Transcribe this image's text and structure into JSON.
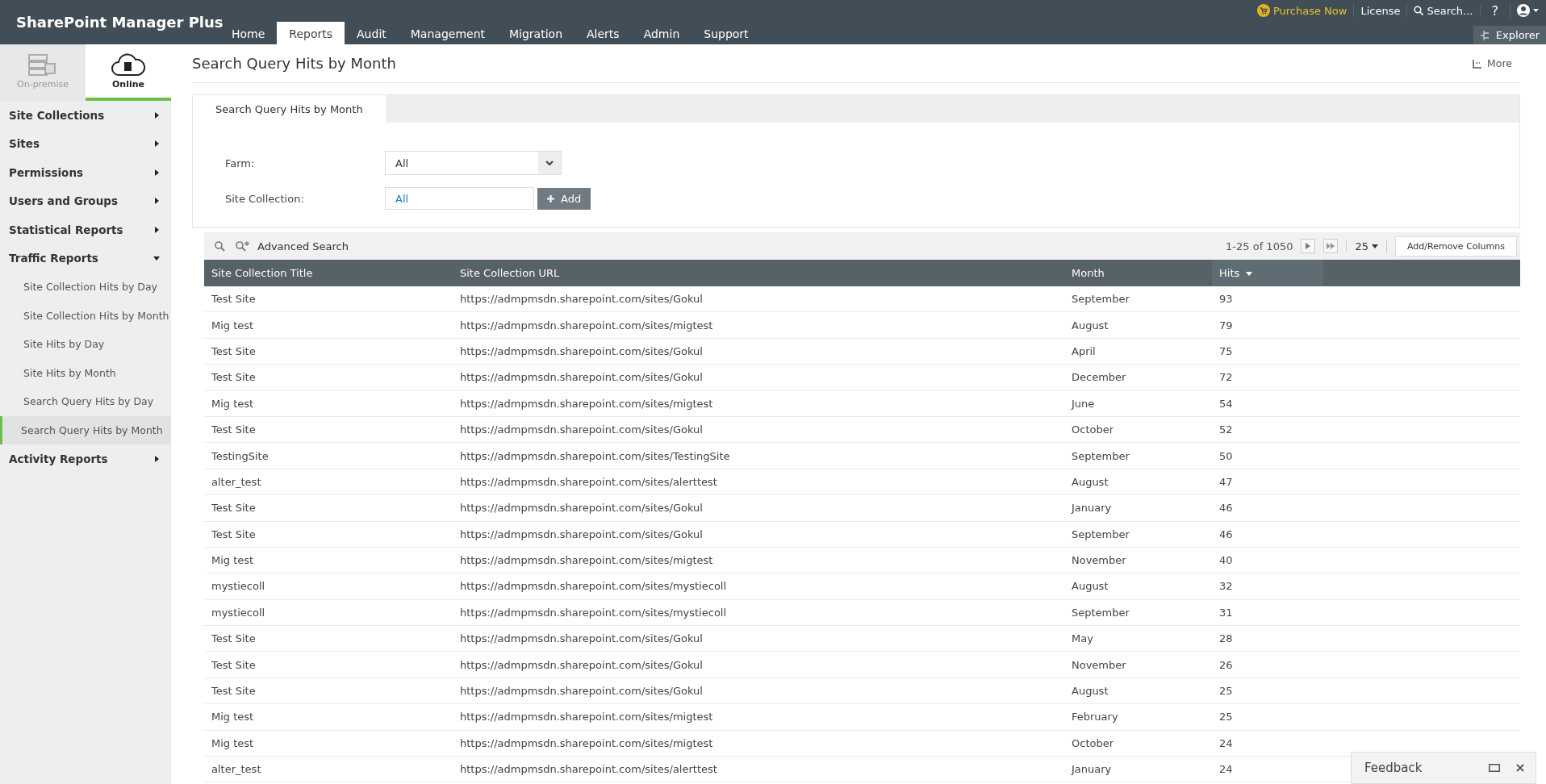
{
  "header": {
    "brand": "SharePoint Manager Plus",
    "tabs": [
      {
        "label": "Home",
        "selected": false
      },
      {
        "label": "Reports",
        "selected": true
      },
      {
        "label": "Audit",
        "selected": false
      },
      {
        "label": "Management",
        "selected": false
      },
      {
        "label": "Migration",
        "selected": false
      },
      {
        "label": "Alerts",
        "selected": false
      },
      {
        "label": "Admin",
        "selected": false
      },
      {
        "label": "Support",
        "selected": false
      }
    ],
    "purchase": "Purchase Now",
    "license": "License",
    "search": "Search...",
    "help": "?",
    "explorer": "Explorer"
  },
  "sidebar": {
    "modes": [
      {
        "label": "On-premise",
        "selected": false
      },
      {
        "label": "Online",
        "selected": true
      }
    ],
    "items": [
      {
        "label": "Site Collections",
        "expanded": false
      },
      {
        "label": "Sites",
        "expanded": false
      },
      {
        "label": "Permissions",
        "expanded": false
      },
      {
        "label": "Users and Groups",
        "expanded": false
      },
      {
        "label": "Statistical Reports",
        "expanded": false
      },
      {
        "label": "Traffic Reports",
        "expanded": true,
        "children": [
          {
            "label": "Site Collection Hits by Day",
            "selected": false
          },
          {
            "label": "Site Collection Hits by Month",
            "selected": false
          },
          {
            "label": "Site Hits by Day",
            "selected": false
          },
          {
            "label": "Site Hits by Month",
            "selected": false
          },
          {
            "label": "Search Query Hits by Day",
            "selected": false
          },
          {
            "label": "Search Query Hits by Month",
            "selected": true
          }
        ]
      },
      {
        "label": "Activity Reports",
        "expanded": false
      }
    ]
  },
  "page": {
    "title": "Search Query Hits by Month",
    "more": "More",
    "tab": "Search Query Hits by Month",
    "filters": [
      {
        "label": "Farm:",
        "value": "All",
        "kind": "select"
      },
      {
        "label": "Site Collection:",
        "value": "All",
        "kind": "picker",
        "button": "Add"
      }
    ]
  },
  "table": {
    "toolbar": {
      "advanced_search": "Advanced Search",
      "range": "1-25 of 1050",
      "page_size": "25",
      "columns_button": "Add/Remove Columns"
    },
    "columns": [
      {
        "label": "Site Collection Title",
        "sorted": false
      },
      {
        "label": "Site Collection URL",
        "sorted": false
      },
      {
        "label": "Month",
        "sorted": false
      },
      {
        "label": "Hits",
        "sorted": true
      }
    ],
    "rows": [
      [
        "Test Site",
        "https://admpmsdn.sharepoint.com/sites/Gokul",
        "September",
        "93"
      ],
      [
        "Mig test",
        "https://admpmsdn.sharepoint.com/sites/migtest",
        "August",
        "79"
      ],
      [
        "Test Site",
        "https://admpmsdn.sharepoint.com/sites/Gokul",
        "April",
        "75"
      ],
      [
        "Test Site",
        "https://admpmsdn.sharepoint.com/sites/Gokul",
        "December",
        "72"
      ],
      [
        "Mig test",
        "https://admpmsdn.sharepoint.com/sites/migtest",
        "June",
        "54"
      ],
      [
        "Test Site",
        "https://admpmsdn.sharepoint.com/sites/Gokul",
        "October",
        "52"
      ],
      [
        "TestingSite",
        "https://admpmsdn.sharepoint.com/sites/TestingSite",
        "September",
        "50"
      ],
      [
        "alter_test",
        "https://admpmsdn.sharepoint.com/sites/alerttest",
        "August",
        "47"
      ],
      [
        "Test Site",
        "https://admpmsdn.sharepoint.com/sites/Gokul",
        "January",
        "46"
      ],
      [
        "Test Site",
        "https://admpmsdn.sharepoint.com/sites/Gokul",
        "September",
        "46"
      ],
      [
        "Mig test",
        "https://admpmsdn.sharepoint.com/sites/migtest",
        "November",
        "40"
      ],
      [
        "mystiecoll",
        "https://admpmsdn.sharepoint.com/sites/mystiecoll",
        "August",
        "32"
      ],
      [
        "mystiecoll",
        "https://admpmsdn.sharepoint.com/sites/mystiecoll",
        "September",
        "31"
      ],
      [
        "Test Site",
        "https://admpmsdn.sharepoint.com/sites/Gokul",
        "May",
        "28"
      ],
      [
        "Test Site",
        "https://admpmsdn.sharepoint.com/sites/Gokul",
        "November",
        "26"
      ],
      [
        "Test Site",
        "https://admpmsdn.sharepoint.com/sites/Gokul",
        "August",
        "25"
      ],
      [
        "Mig test",
        "https://admpmsdn.sharepoint.com/sites/migtest",
        "February",
        "25"
      ],
      [
        "Mig test",
        "https://admpmsdn.sharepoint.com/sites/migtest",
        "October",
        "24"
      ],
      [
        "alter_test",
        "https://admpmsdn.sharepoint.com/sites/alerttest",
        "January",
        "24"
      ]
    ]
  },
  "feedback": {
    "label": "Feedback"
  }
}
